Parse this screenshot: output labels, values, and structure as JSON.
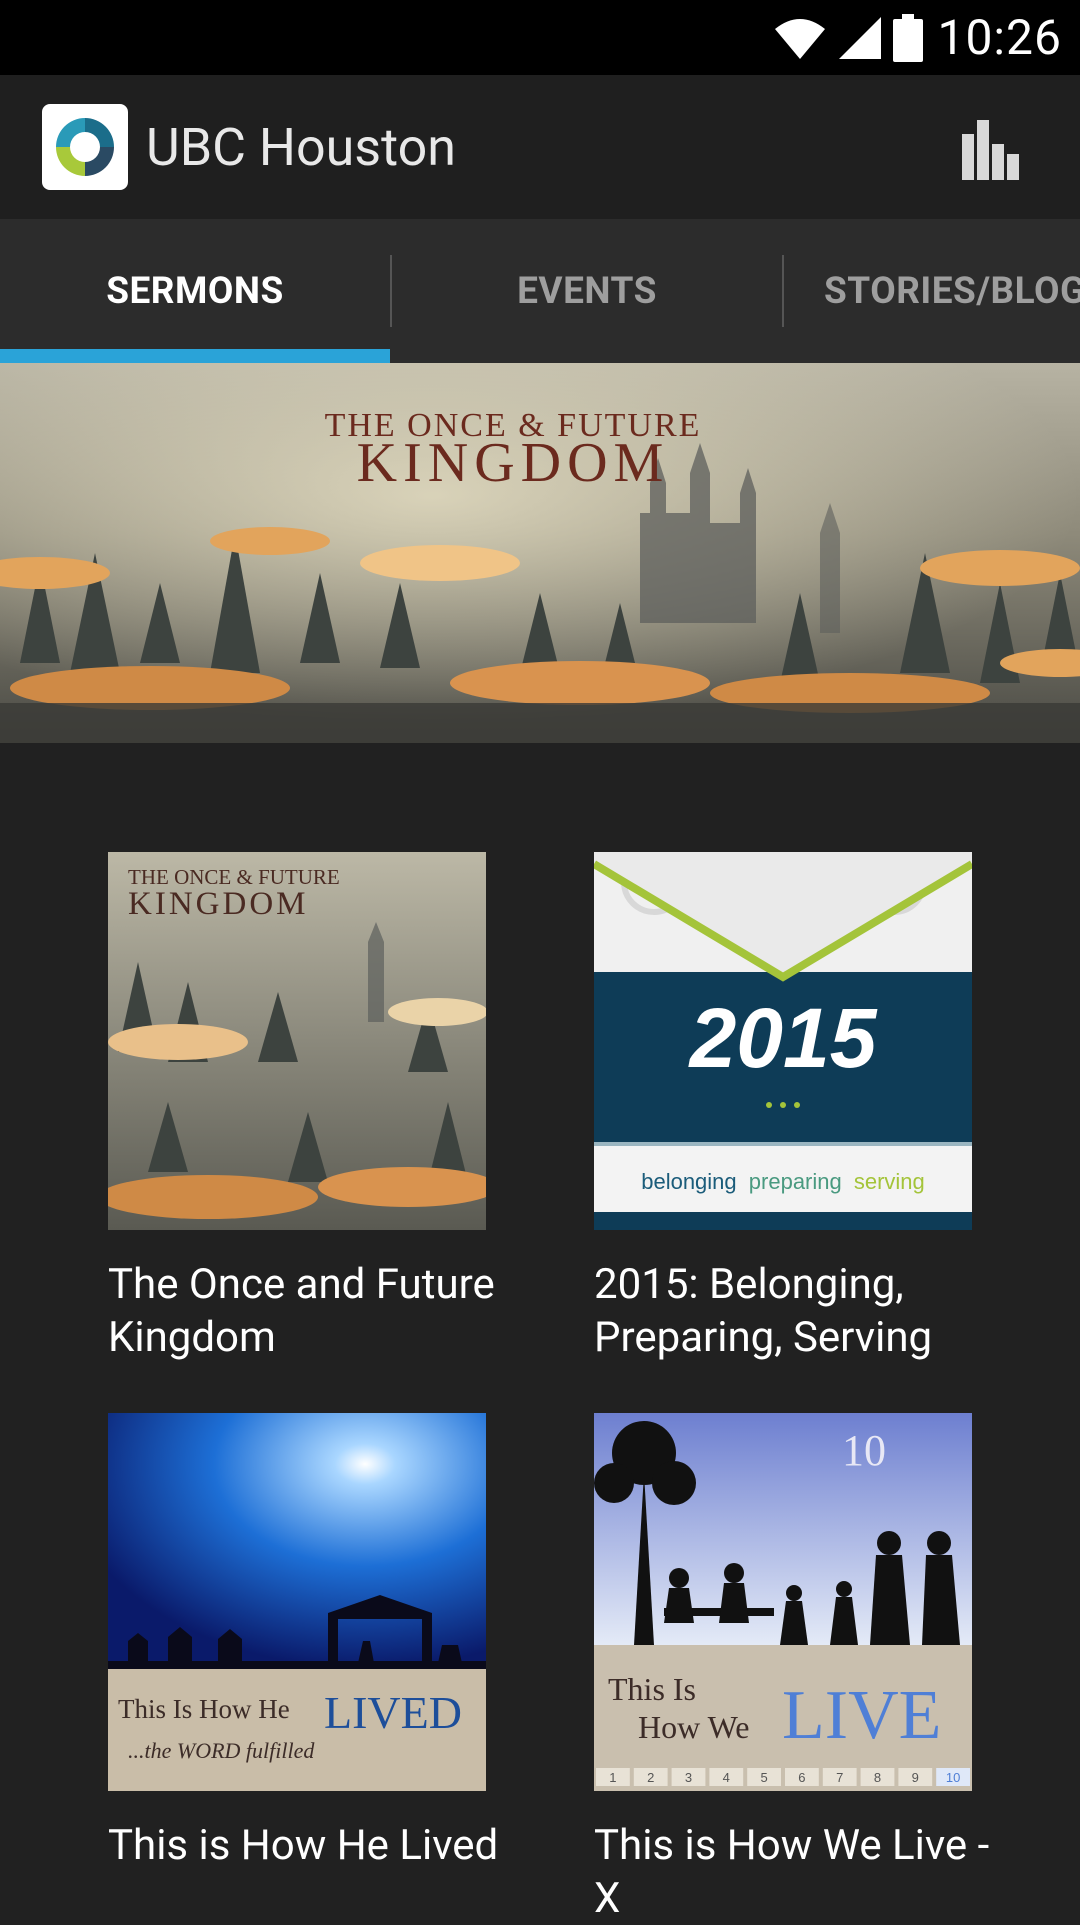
{
  "status_bar": {
    "time": "10:26"
  },
  "app_bar": {
    "title": "UBC Houston"
  },
  "tabs": [
    {
      "label": "SERMONS",
      "active": true
    },
    {
      "label": "EVENTS",
      "active": false
    },
    {
      "label": "STORIES/BLOG",
      "active": false
    }
  ],
  "banner": {
    "line1": "THE ONCE & FUTURE",
    "line2": "KINGDOM"
  },
  "sermons": [
    {
      "title": "The Once and Future Kingdom",
      "art_line1": "THE ONCE & FUTURE",
      "art_line2": "KINGDOM"
    },
    {
      "title": "2015: Belonging, Preparing, Serving",
      "art_year": "2015",
      "art_words": [
        "belonging",
        "preparing",
        "serving"
      ]
    },
    {
      "title": "This is How He Lived",
      "art_line1": "This Is How He",
      "art_big": "LIVED",
      "art_sub": "...the WORD fulfilled"
    },
    {
      "title": "This is How We Live - X",
      "art_num": "10",
      "art_line1": "This Is",
      "art_line2": "How We",
      "art_big": "LIVE",
      "art_ruler": [
        "1",
        "2",
        "3",
        "4",
        "5",
        "6",
        "7",
        "8",
        "9",
        "10"
      ]
    }
  ],
  "colors": {
    "accent": "#2aa3d8",
    "background": "#212121",
    "tabs": "#2c2c2c"
  }
}
